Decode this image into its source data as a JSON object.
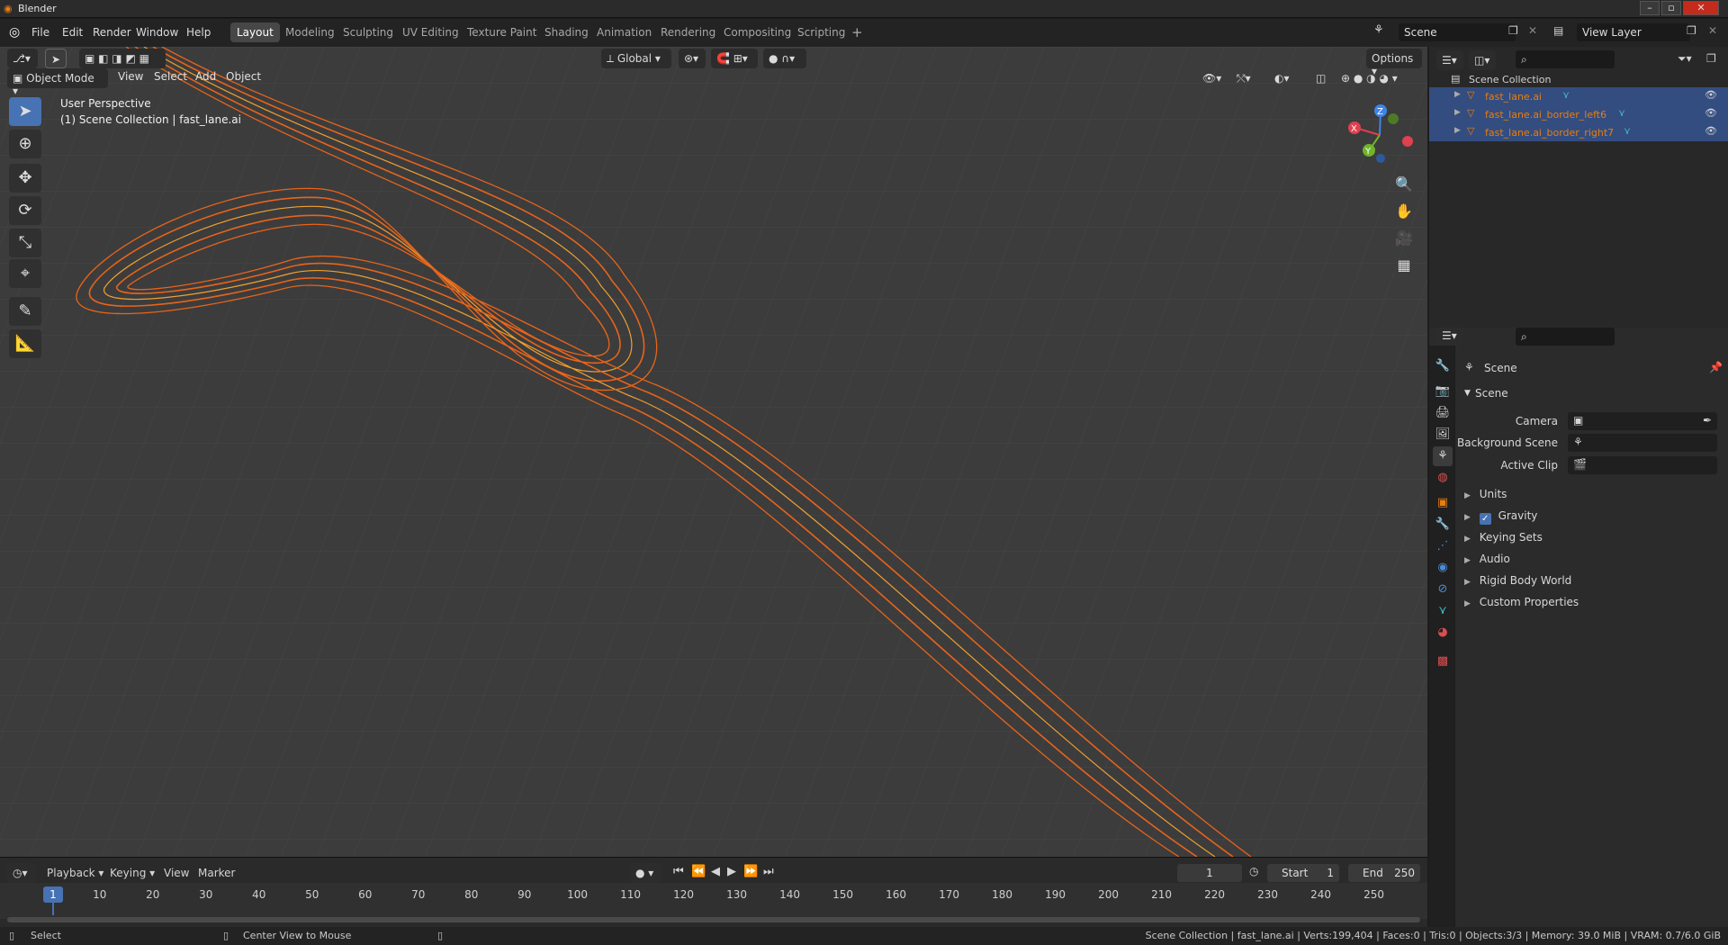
{
  "titlebar": {
    "app_title": "Blender"
  },
  "menu": {
    "items": [
      "File",
      "Edit",
      "Render",
      "Window",
      "Help"
    ]
  },
  "workspaces": [
    "Layout",
    "Modeling",
    "Sculpting",
    "UV Editing",
    "Texture Paint",
    "Shading",
    "Animation",
    "Rendering",
    "Compositing",
    "Scripting"
  ],
  "active_workspace": "Layout",
  "scene_selector": {
    "value": "Scene"
  },
  "view_layer_selector": {
    "value": "View Layer"
  },
  "viewport": {
    "mode": "Object Mode",
    "header_menus": [
      "View",
      "Select",
      "Add",
      "Object"
    ],
    "transform_orientation": "Global",
    "options_label": "Options",
    "overlay_text_line1": "User Perspective",
    "overlay_text_line2": "(1) Scene Collection | fast_lane.ai",
    "gizmo_axes": {
      "x": "X",
      "y": "Y",
      "z": "Z"
    }
  },
  "outliner": {
    "root": "Scene Collection",
    "items": [
      {
        "name": "fast_lane.ai"
      },
      {
        "name": "fast_lane.ai_border_left6"
      },
      {
        "name": "fast_lane.ai_border_right7"
      }
    ]
  },
  "properties": {
    "context": "Scene",
    "panel_title": "Scene",
    "fields": [
      {
        "label": "Camera"
      },
      {
        "label": "Background Scene"
      },
      {
        "label": "Active Clip"
      }
    ],
    "sections": [
      "Units",
      "Gravity",
      "Keying Sets",
      "Audio",
      "Rigid Body World",
      "Custom Properties"
    ],
    "gravity_checked": true
  },
  "timeline": {
    "menus": [
      "Playback",
      "Keying",
      "View",
      "Marker"
    ],
    "current_frame": "1",
    "start_label": "Start",
    "start_value": "1",
    "end_label": "End",
    "end_value": "250",
    "ticks": [
      "1",
      "10",
      "20",
      "30",
      "40",
      "50",
      "60",
      "70",
      "80",
      "90",
      "100",
      "110",
      "120",
      "130",
      "140",
      "150",
      "160",
      "170",
      "180",
      "190",
      "200",
      "210",
      "220",
      "230",
      "240",
      "250"
    ]
  },
  "statusbar": {
    "left_action": "Select",
    "mid_action": "Center View to Mouse",
    "stats": "Scene Collection | fast_lane.ai | Verts:199,404 | Faces:0 | Tris:0 | Objects:3/3 | Memory: 39.0 MiB | VRAM: 0.7/6.0 GiB"
  },
  "colors": {
    "accent_blue": "#4772b3",
    "selection": "#334d80",
    "curve_orange": "#e8641a",
    "curve_yellow": "#f0a030",
    "object_orange": "#e87d0d"
  }
}
